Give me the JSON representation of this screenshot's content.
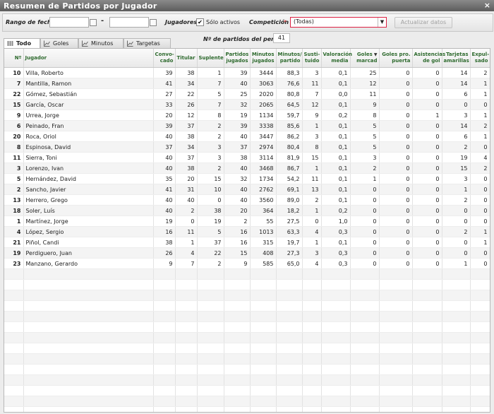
{
  "window": {
    "title": "Resumen de Partidos por Jugador",
    "close": "×"
  },
  "filters": {
    "date_range_label": "Rango de fechas",
    "date_from": "",
    "date_to": "",
    "date_separator": "-",
    "players_label": "Jugadores",
    "only_active_checked": true,
    "only_active_label": "Sólo activos",
    "competition_label": "Competición",
    "required_mark": "*",
    "competition_value": "(Todas)",
    "update_button": "Actualizar datos",
    "matches_count_label": "Nº de partidos del periodo",
    "matches_count": "41"
  },
  "tabs": [
    {
      "label": "Todo",
      "icon": "columns-icon",
      "active": true
    },
    {
      "label": "Goles",
      "icon": "chart-icon",
      "active": false
    },
    {
      "label": "Minutos",
      "icon": "chart-icon",
      "active": false
    },
    {
      "label": "Targetas",
      "icon": "chart-icon",
      "active": false
    }
  ],
  "columns": [
    {
      "label": "Nº"
    },
    {
      "label": "Jugador"
    },
    {
      "label": "Convo-\ncado"
    },
    {
      "label": "Titular"
    },
    {
      "label": "Suplente"
    },
    {
      "label": "Partidos\njugados"
    },
    {
      "label": "Minutos\njugados"
    },
    {
      "label": "Minutos/\npartido"
    },
    {
      "label": "Susti-\ntuido"
    },
    {
      "label": "Valoración\nmedia"
    },
    {
      "label": "Goles\nmarcad"
    },
    {
      "label": "Goles pro.\npuerta"
    },
    {
      "label": "Asistencias\nde gol"
    },
    {
      "label": "Tarjetas\namarillas"
    },
    {
      "label": "Expul-\nsado"
    }
  ],
  "sort_column": "Goles marcad",
  "sort_indicator": "▼",
  "rows": [
    [
      "10",
      "Villa, Roberto",
      "39",
      "38",
      "1",
      "39",
      "3444",
      "88,3",
      "3",
      "0,1",
      "25",
      "0",
      "0",
      "14",
      "2"
    ],
    [
      "7",
      "Mantilla, Ramon",
      "41",
      "34",
      "7",
      "40",
      "3063",
      "76,6",
      "11",
      "0,1",
      "12",
      "0",
      "0",
      "14",
      "1"
    ],
    [
      "22",
      "Gómez, Sebastián",
      "27",
      "22",
      "5",
      "25",
      "2020",
      "80,8",
      "7",
      "0,0",
      "11",
      "0",
      "0",
      "6",
      "1"
    ],
    [
      "15",
      "García, Oscar",
      "33",
      "26",
      "7",
      "32",
      "2065",
      "64,5",
      "12",
      "0,1",
      "9",
      "0",
      "0",
      "0",
      "0"
    ],
    [
      "9",
      "Urrea, Jorge",
      "20",
      "12",
      "8",
      "19",
      "1134",
      "59,7",
      "9",
      "0,2",
      "8",
      "0",
      "1",
      "3",
      "1"
    ],
    [
      "6",
      "Peinado, Fran",
      "39",
      "37",
      "2",
      "39",
      "3338",
      "85,6",
      "1",
      "0,1",
      "5",
      "0",
      "0",
      "14",
      "2"
    ],
    [
      "20",
      "Roca, Oriol",
      "40",
      "38",
      "2",
      "40",
      "3447",
      "86,2",
      "3",
      "0,1",
      "5",
      "0",
      "0",
      "6",
      "1"
    ],
    [
      "8",
      "Espinosa, David",
      "37",
      "34",
      "3",
      "37",
      "2974",
      "80,4",
      "8",
      "0,1",
      "5",
      "0",
      "0",
      "2",
      "0"
    ],
    [
      "11",
      "Sierra, Toni",
      "40",
      "37",
      "3",
      "38",
      "3114",
      "81,9",
      "15",
      "0,1",
      "3",
      "0",
      "0",
      "19",
      "4"
    ],
    [
      "3",
      "Lorenzo, Ivan",
      "40",
      "38",
      "2",
      "40",
      "3468",
      "86,7",
      "1",
      "0,1",
      "2",
      "0",
      "0",
      "15",
      "2"
    ],
    [
      "5",
      "Hernández, David",
      "35",
      "20",
      "15",
      "32",
      "1734",
      "54,2",
      "11",
      "0,1",
      "1",
      "0",
      "0",
      "3",
      "0"
    ],
    [
      "2",
      "Sancho, Javier",
      "41",
      "31",
      "10",
      "40",
      "2762",
      "69,1",
      "13",
      "0,1",
      "0",
      "0",
      "0",
      "1",
      "0"
    ],
    [
      "13",
      "Herrero, Grego",
      "40",
      "40",
      "0",
      "40",
      "3560",
      "89,0",
      "2",
      "0,1",
      "0",
      "0",
      "0",
      "2",
      "0"
    ],
    [
      "18",
      "Soler, Luís",
      "40",
      "2",
      "38",
      "20",
      "364",
      "18,2",
      "1",
      "0,2",
      "0",
      "0",
      "0",
      "0",
      "0"
    ],
    [
      "1",
      "Martínez, Jorge",
      "19",
      "0",
      "19",
      "2",
      "55",
      "27,5",
      "0",
      "1,0",
      "0",
      "0",
      "0",
      "0",
      "0"
    ],
    [
      "4",
      "López, Sergio",
      "16",
      "11",
      "5",
      "16",
      "1013",
      "63,3",
      "4",
      "0,3",
      "0",
      "0",
      "0",
      "2",
      "1"
    ],
    [
      "21",
      "Piñol, Candi",
      "38",
      "1",
      "37",
      "16",
      "315",
      "19,7",
      "1",
      "0,1",
      "0",
      "0",
      "0",
      "0",
      "1"
    ],
    [
      "19",
      "Perdiguero, Juan",
      "26",
      "4",
      "22",
      "15",
      "408",
      "27,3",
      "3",
      "0,3",
      "0",
      "0",
      "0",
      "0",
      "0"
    ],
    [
      "23",
      "Manzano, Gerardo",
      "9",
      "7",
      "2",
      "9",
      "585",
      "65,0",
      "4",
      "0,3",
      "0",
      "0",
      "0",
      "1",
      "0"
    ]
  ],
  "empty_rows": 15
}
